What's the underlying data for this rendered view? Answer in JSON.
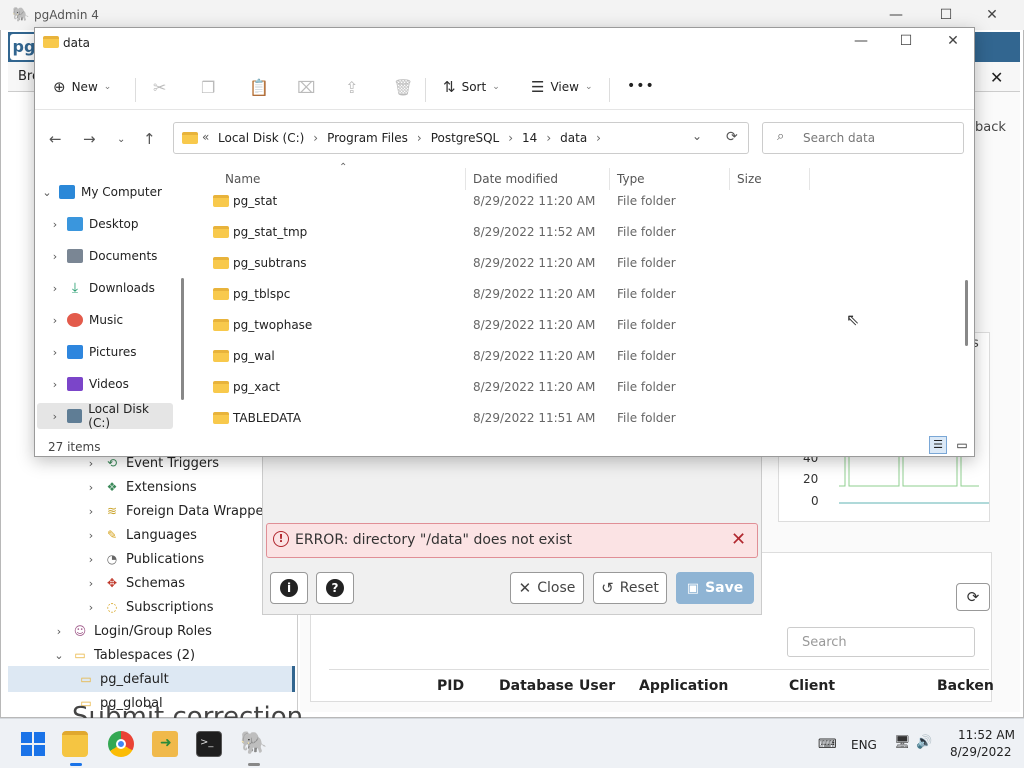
{
  "pgadmin": {
    "window_title": "pgAdmin 4",
    "logo": "pg",
    "browser_label": "Bro",
    "background_right_text": "back",
    "background_tab_s": "s",
    "chart_ticks": [
      "40",
      "20",
      "0"
    ],
    "tree": [
      {
        "label": "Event Triggers",
        "expanded": false
      },
      {
        "label": "Extensions",
        "expanded": false
      },
      {
        "label": "Foreign Data Wrappers",
        "expanded": false
      },
      {
        "label": "Languages",
        "expanded": false
      },
      {
        "label": "Publications",
        "expanded": false
      },
      {
        "label": "Schemas",
        "expanded": false
      },
      {
        "label": "Subscriptions",
        "expanded": false
      },
      {
        "label": "Login/Group Roles",
        "expanded": false
      },
      {
        "label": "Tablespaces (2)",
        "expanded": true
      },
      {
        "label": "pg_default",
        "selected": true
      },
      {
        "label": "pg_global"
      }
    ],
    "overlay_text": "Submit correction",
    "search_placeholder": "Search",
    "table_columns": [
      "PID",
      "Database",
      "User",
      "Application",
      "Client",
      "Backen"
    ]
  },
  "dialog": {
    "error_message": "ERROR: directory \"/data\" does not exist",
    "close_label": "Close",
    "reset_label": "Reset",
    "save_label": "Save",
    "info_icon": "info-icon",
    "help_icon": "help-icon"
  },
  "explorer": {
    "title": "data",
    "toolbar": {
      "new_label": "New",
      "sort_label": "Sort",
      "view_label": "View",
      "more_label": "•••"
    },
    "breadcrumb": [
      "Local Disk (C:)",
      "Program Files",
      "PostgreSQL",
      "14",
      "data"
    ],
    "breadcrumb_prefix": "«",
    "search_placeholder": "Search data",
    "nav_items": [
      {
        "label": "My Computer",
        "color": "#2b88d8",
        "expanded": true
      },
      {
        "label": "Desktop",
        "color": "#3a96dd"
      },
      {
        "label": "Documents",
        "color": "#7a8694"
      },
      {
        "label": "Downloads",
        "color": "#1f9a6b"
      },
      {
        "label": "Music",
        "color": "#e35b4b"
      },
      {
        "label": "Pictures",
        "color": "#2e86de"
      },
      {
        "label": "Videos",
        "color": "#7b45c9"
      },
      {
        "label": "Local Disk (C:)",
        "color": "#5f7d95",
        "selected": true
      }
    ],
    "columns": {
      "name": "Name",
      "date": "Date modified",
      "type": "Type",
      "size": "Size"
    },
    "files": [
      {
        "name": "pg_stat",
        "date": "8/29/2022 11:20 AM",
        "type": "File folder"
      },
      {
        "name": "pg_stat_tmp",
        "date": "8/29/2022 11:52 AM",
        "type": "File folder"
      },
      {
        "name": "pg_subtrans",
        "date": "8/29/2022 11:20 AM",
        "type": "File folder"
      },
      {
        "name": "pg_tblspc",
        "date": "8/29/2022 11:20 AM",
        "type": "File folder"
      },
      {
        "name": "pg_twophase",
        "date": "8/29/2022 11:20 AM",
        "type": "File folder"
      },
      {
        "name": "pg_wal",
        "date": "8/29/2022 11:20 AM",
        "type": "File folder"
      },
      {
        "name": "pg_xact",
        "date": "8/29/2022 11:20 AM",
        "type": "File folder"
      },
      {
        "name": "TABLEDATA",
        "date": "8/29/2022 11:51 AM",
        "type": "File folder"
      }
    ],
    "status": "27 items"
  },
  "taskbar": {
    "language": "ENG",
    "time": "11:52 AM",
    "date": "8/29/2022"
  },
  "colors": {
    "pg_blue": "#326690",
    "error_red": "#b1282f",
    "save_button": "#8fb4d4"
  }
}
